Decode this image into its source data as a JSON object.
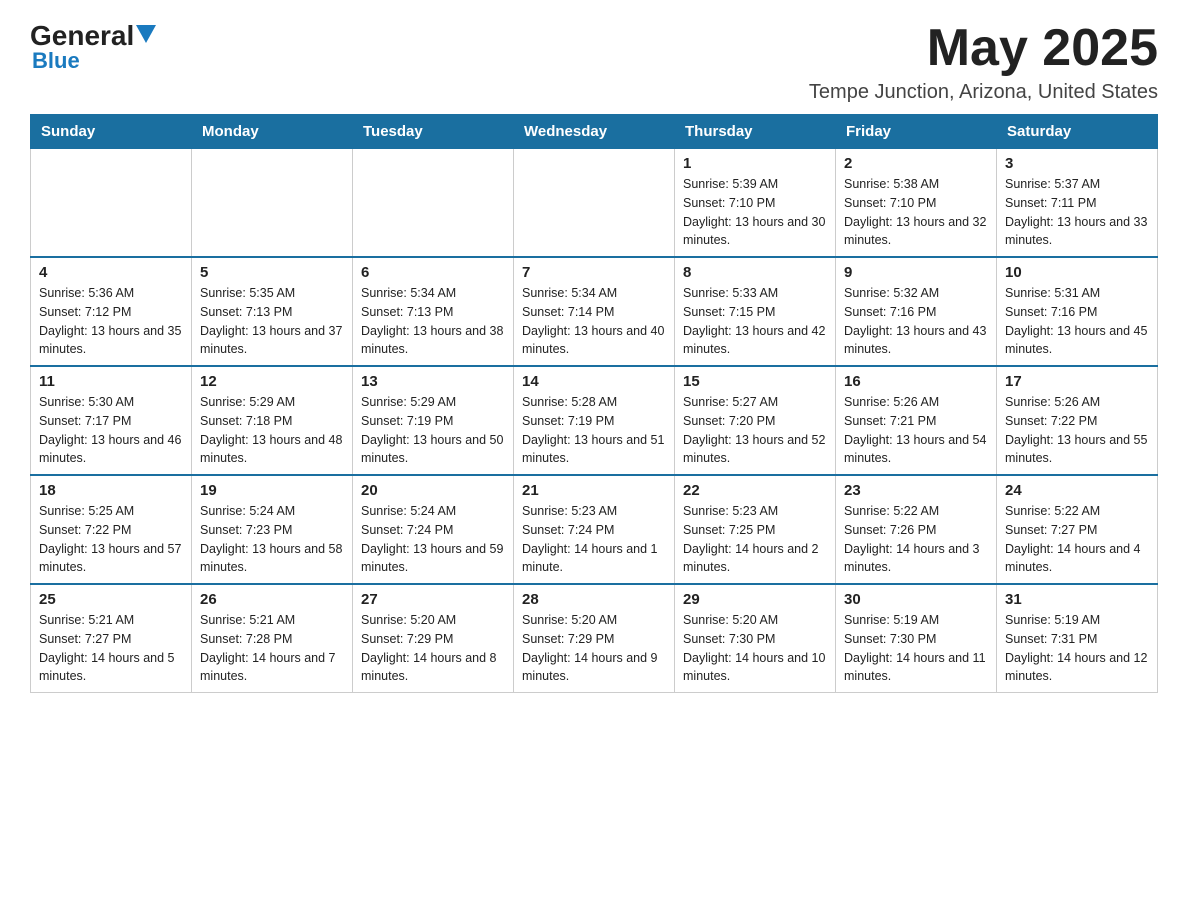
{
  "header": {
    "logo_general": "General",
    "logo_blue": "Blue",
    "month_title": "May 2025",
    "location": "Tempe Junction, Arizona, United States"
  },
  "calendar": {
    "days_of_week": [
      "Sunday",
      "Monday",
      "Tuesday",
      "Wednesday",
      "Thursday",
      "Friday",
      "Saturday"
    ],
    "weeks": [
      [
        {
          "day": "",
          "info": ""
        },
        {
          "day": "",
          "info": ""
        },
        {
          "day": "",
          "info": ""
        },
        {
          "day": "",
          "info": ""
        },
        {
          "day": "1",
          "info": "Sunrise: 5:39 AM\nSunset: 7:10 PM\nDaylight: 13 hours and 30 minutes."
        },
        {
          "day": "2",
          "info": "Sunrise: 5:38 AM\nSunset: 7:10 PM\nDaylight: 13 hours and 32 minutes."
        },
        {
          "day": "3",
          "info": "Sunrise: 5:37 AM\nSunset: 7:11 PM\nDaylight: 13 hours and 33 minutes."
        }
      ],
      [
        {
          "day": "4",
          "info": "Sunrise: 5:36 AM\nSunset: 7:12 PM\nDaylight: 13 hours and 35 minutes."
        },
        {
          "day": "5",
          "info": "Sunrise: 5:35 AM\nSunset: 7:13 PM\nDaylight: 13 hours and 37 minutes."
        },
        {
          "day": "6",
          "info": "Sunrise: 5:34 AM\nSunset: 7:13 PM\nDaylight: 13 hours and 38 minutes."
        },
        {
          "day": "7",
          "info": "Sunrise: 5:34 AM\nSunset: 7:14 PM\nDaylight: 13 hours and 40 minutes."
        },
        {
          "day": "8",
          "info": "Sunrise: 5:33 AM\nSunset: 7:15 PM\nDaylight: 13 hours and 42 minutes."
        },
        {
          "day": "9",
          "info": "Sunrise: 5:32 AM\nSunset: 7:16 PM\nDaylight: 13 hours and 43 minutes."
        },
        {
          "day": "10",
          "info": "Sunrise: 5:31 AM\nSunset: 7:16 PM\nDaylight: 13 hours and 45 minutes."
        }
      ],
      [
        {
          "day": "11",
          "info": "Sunrise: 5:30 AM\nSunset: 7:17 PM\nDaylight: 13 hours and 46 minutes."
        },
        {
          "day": "12",
          "info": "Sunrise: 5:29 AM\nSunset: 7:18 PM\nDaylight: 13 hours and 48 minutes."
        },
        {
          "day": "13",
          "info": "Sunrise: 5:29 AM\nSunset: 7:19 PM\nDaylight: 13 hours and 50 minutes."
        },
        {
          "day": "14",
          "info": "Sunrise: 5:28 AM\nSunset: 7:19 PM\nDaylight: 13 hours and 51 minutes."
        },
        {
          "day": "15",
          "info": "Sunrise: 5:27 AM\nSunset: 7:20 PM\nDaylight: 13 hours and 52 minutes."
        },
        {
          "day": "16",
          "info": "Sunrise: 5:26 AM\nSunset: 7:21 PM\nDaylight: 13 hours and 54 minutes."
        },
        {
          "day": "17",
          "info": "Sunrise: 5:26 AM\nSunset: 7:22 PM\nDaylight: 13 hours and 55 minutes."
        }
      ],
      [
        {
          "day": "18",
          "info": "Sunrise: 5:25 AM\nSunset: 7:22 PM\nDaylight: 13 hours and 57 minutes."
        },
        {
          "day": "19",
          "info": "Sunrise: 5:24 AM\nSunset: 7:23 PM\nDaylight: 13 hours and 58 minutes."
        },
        {
          "day": "20",
          "info": "Sunrise: 5:24 AM\nSunset: 7:24 PM\nDaylight: 13 hours and 59 minutes."
        },
        {
          "day": "21",
          "info": "Sunrise: 5:23 AM\nSunset: 7:24 PM\nDaylight: 14 hours and 1 minute."
        },
        {
          "day": "22",
          "info": "Sunrise: 5:23 AM\nSunset: 7:25 PM\nDaylight: 14 hours and 2 minutes."
        },
        {
          "day": "23",
          "info": "Sunrise: 5:22 AM\nSunset: 7:26 PM\nDaylight: 14 hours and 3 minutes."
        },
        {
          "day": "24",
          "info": "Sunrise: 5:22 AM\nSunset: 7:27 PM\nDaylight: 14 hours and 4 minutes."
        }
      ],
      [
        {
          "day": "25",
          "info": "Sunrise: 5:21 AM\nSunset: 7:27 PM\nDaylight: 14 hours and 5 minutes."
        },
        {
          "day": "26",
          "info": "Sunrise: 5:21 AM\nSunset: 7:28 PM\nDaylight: 14 hours and 7 minutes."
        },
        {
          "day": "27",
          "info": "Sunrise: 5:20 AM\nSunset: 7:29 PM\nDaylight: 14 hours and 8 minutes."
        },
        {
          "day": "28",
          "info": "Sunrise: 5:20 AM\nSunset: 7:29 PM\nDaylight: 14 hours and 9 minutes."
        },
        {
          "day": "29",
          "info": "Sunrise: 5:20 AM\nSunset: 7:30 PM\nDaylight: 14 hours and 10 minutes."
        },
        {
          "day": "30",
          "info": "Sunrise: 5:19 AM\nSunset: 7:30 PM\nDaylight: 14 hours and 11 minutes."
        },
        {
          "day": "31",
          "info": "Sunrise: 5:19 AM\nSunset: 7:31 PM\nDaylight: 14 hours and 12 minutes."
        }
      ]
    ]
  }
}
